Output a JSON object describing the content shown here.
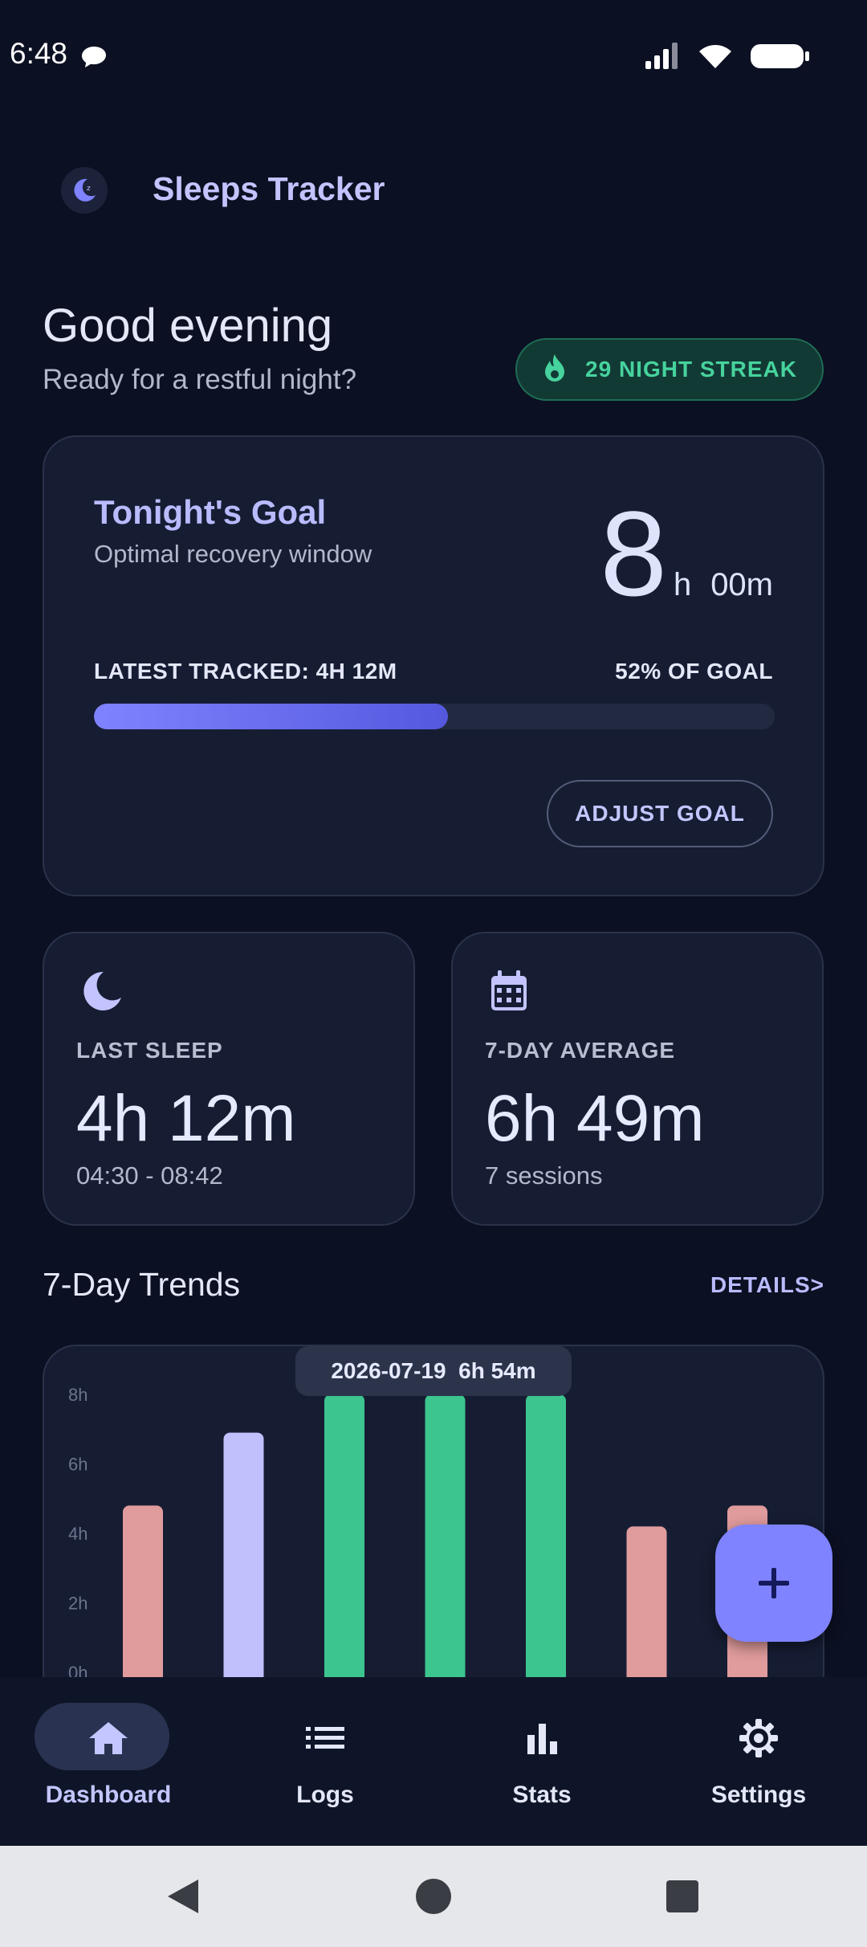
{
  "status_bar": {
    "time": "6:48"
  },
  "app": {
    "title": "Sleeps Tracker"
  },
  "greeting": {
    "title": "Good evening",
    "subtitle": "Ready for a restful night?"
  },
  "streak": {
    "label": "29 NIGHT STREAK"
  },
  "goal": {
    "title": "Tonight's Goal",
    "subtitle": "Optimal recovery window",
    "hours": "8",
    "hours_unit": "h",
    "minutes": "00m",
    "tracked_label": "LATEST TRACKED: 4H 12M",
    "percent_label": "52% OF GOAL",
    "progress_fraction": 0.52,
    "adjust_label": "ADJUST GOAL"
  },
  "last_sleep": {
    "label": "LAST SLEEP",
    "value": "4h 12m",
    "range": "04:30 - 08:42"
  },
  "average": {
    "label": "7-DAY AVERAGE",
    "value": "6h 49m",
    "sessions": "7 sessions"
  },
  "trends": {
    "title": "7-Day Trends",
    "details_label": "DETAILS>",
    "tooltip": "2026-07-19  6h 54m"
  },
  "chart_data": {
    "type": "bar",
    "y_ticks": [
      "8h",
      "6h",
      "4h",
      "2h",
      "0h"
    ],
    "ylim": [
      0,
      8
    ],
    "values": [
      4.8,
      6.9,
      8.0,
      8.0,
      8.0,
      4.2,
      4.8
    ],
    "bar_colors": [
      "#e09b9c",
      "#c1c0fd",
      "#3dc58f",
      "#3dc58f",
      "#3dc58f",
      "#e09b9c",
      "#e09b9c"
    ],
    "grid": false
  },
  "nav": {
    "items": [
      {
        "label": "Dashboard",
        "icon": "home-icon",
        "active": true
      },
      {
        "label": "Logs",
        "icon": "list-icon",
        "active": false
      },
      {
        "label": "Stats",
        "icon": "bar-chart-icon",
        "active": false
      },
      {
        "label": "Settings",
        "icon": "gear-icon",
        "active": false
      }
    ]
  },
  "colors": {
    "background": "#0b1022",
    "accent": "#7f83ff",
    "card": "#161d33",
    "streak_green": "#46d39d"
  }
}
